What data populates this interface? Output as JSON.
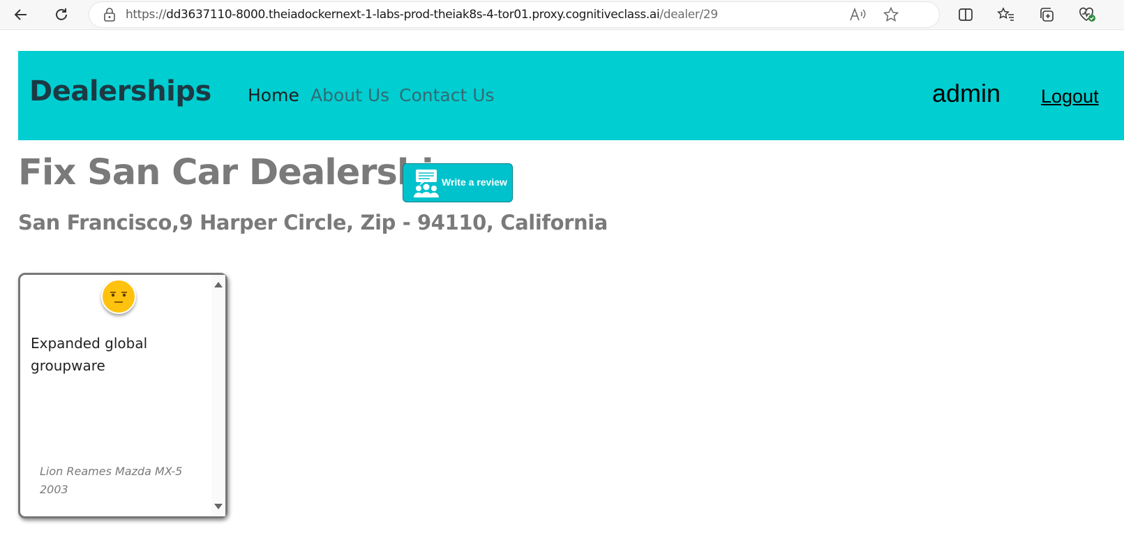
{
  "browser": {
    "url_prefix": "https://",
    "url_host": "dd3637110-8000.theiadockernext-1-labs-prod-theiak8s-4-tor01.proxy.cognitiveclass.ai",
    "url_path": "/dealer/29",
    "icons": [
      "back-icon",
      "refresh-icon",
      "lock-icon",
      "read-aloud-icon",
      "favorite-star-icon",
      "split-screen-icon",
      "favorites-icon",
      "collections-icon",
      "browser-essentials-icon"
    ]
  },
  "navbar": {
    "brand": "Dealerships",
    "links": [
      "Home",
      "About Us",
      "Contact Us"
    ],
    "user": "admin",
    "logout": "Logout",
    "bg_color": "#00ced1"
  },
  "dealer": {
    "name": "Fix San Car Dealership",
    "address": "San Francisco,9 Harper Circle, Zip - 94110, California",
    "review_button_label": "Write a review"
  },
  "reviews": [
    {
      "sentiment_icon": "neutral-face-icon",
      "text": "Expanded global groupware",
      "car_line1": "Lion Reames Mazda MX-5",
      "car_line2": "2003"
    }
  ]
}
